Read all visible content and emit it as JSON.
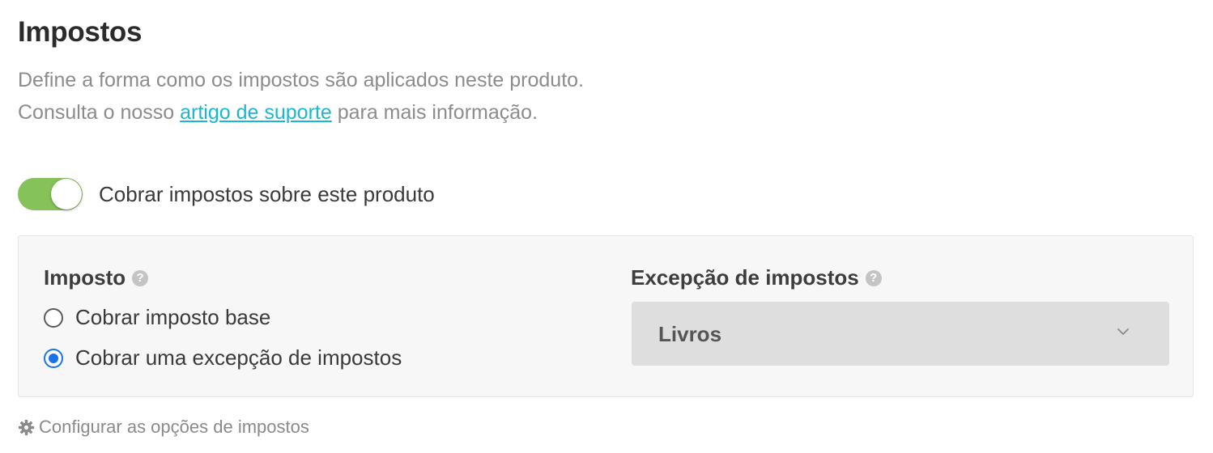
{
  "section": {
    "title": "Impostos",
    "description_line1": "Define a forma como os impostos são aplicados neste produto.",
    "description_line2_before": "Consulta o nosso ",
    "description_link": "artigo de suporte",
    "description_line2_after": " para mais informação."
  },
  "toggle": {
    "label": "Cobrar impostos sobre este produto",
    "on": true,
    "color_on": "#86c25a"
  },
  "tax": {
    "label": "Imposto",
    "help_icon": "question-circle-icon",
    "options": [
      {
        "label": "Cobrar imposto base",
        "selected": false
      },
      {
        "label": "Cobrar uma excepção de impostos",
        "selected": true
      }
    ]
  },
  "exception": {
    "label": "Excepção de impostos",
    "help_icon": "question-circle-icon",
    "selected_value": "Livros",
    "dropdown_icon": "chevron-down-icon"
  },
  "footer": {
    "icon": "gear-icon",
    "link_label": "Configurar as opções de impostos"
  },
  "colors": {
    "link": "#1bb6d1",
    "radio_selected": "#1a73e8"
  }
}
